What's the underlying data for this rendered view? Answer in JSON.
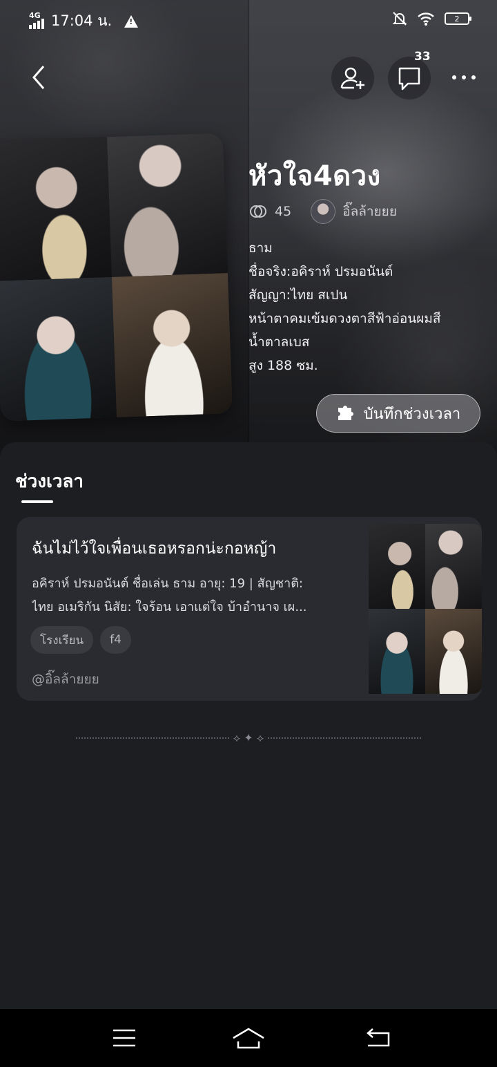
{
  "status_bar": {
    "network": "4G",
    "time": "17:04 น.",
    "battery": "2"
  },
  "header": {
    "comment_count": "33"
  },
  "story": {
    "title": "หัวใจ4ดวง",
    "reads": "45",
    "author": "อิ๊ลล้ายยย",
    "description": [
      "ธาม",
      "ชื่อจริง:อคิราห์ ปรมอนันต์",
      "สัญญา:ไทย สเปน",
      "หน้าตาคมเข้มดวงตาสีฟ้าอ่อนผมสี",
      "น้ำตาลเบส",
      "สูง 188 ซม."
    ],
    "timeline_button": "บันทึกช่วงเวลา"
  },
  "section": {
    "tab_label": "ช่วงเวลา"
  },
  "card": {
    "title": "ฉันไม่ไว้ใจเพื่อนเธอหรอกน่ะกอหญ้า",
    "desc_lines": [
      "อคิราห์ ปรมอนันต์ ชื่อเล่น ธาม อายุ: 19 | สัญชาติ:",
      "ไทย อเมริกัน นิสัย: ใจร้อน เอาแต่ใจ บ้าอำนาจ เผ..."
    ],
    "tags": [
      "โรงเรียน",
      "f4"
    ],
    "author": "@อิ๊ลล้ายยย"
  },
  "icons": {
    "back": "chevron-left-icon",
    "follow": "add-user-icon",
    "comment": "comment-icon",
    "more": "more-dots-icon",
    "reads": "spiral-icon",
    "puzzle": "puzzle-icon",
    "menu": "menu-icon",
    "home": "home-icon",
    "return": "return-icon"
  }
}
